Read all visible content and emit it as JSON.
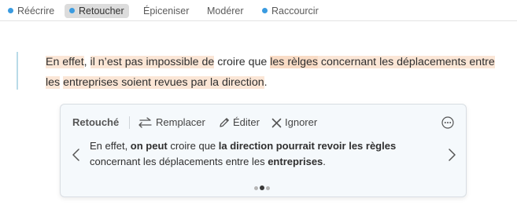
{
  "toolbar": {
    "items": [
      {
        "label": "Réécrire",
        "dot": true
      },
      {
        "label": "Retoucher",
        "dot": true,
        "active": true
      },
      {
        "label": "Épiceniser",
        "dot": false
      },
      {
        "label": "Modérer",
        "dot": false
      },
      {
        "label": "Raccourcir",
        "dot": true
      }
    ]
  },
  "document": {
    "segments": [
      {
        "text": "En effet",
        "hl": "a"
      },
      {
        "text": ", ",
        "hl": ""
      },
      {
        "text": "il n’est pas impossible de",
        "hl": "a"
      },
      {
        "text": " croire que ",
        "hl": ""
      },
      {
        "text": "les rèlges",
        "hl": "b"
      },
      {
        "text": " concernant les déplacements entre les",
        "hl": "a"
      },
      {
        "text": " ",
        "hl": ""
      },
      {
        "text": "entreprises soient revues par la direction",
        "hl": "a"
      },
      {
        "text": ".",
        "hl": ""
      }
    ]
  },
  "card": {
    "title": "Retouché",
    "replace_label": "Remplacer",
    "edit_label": "Éditer",
    "ignore_label": "Ignorer",
    "suggestion": {
      "parts": [
        {
          "text": "En effet, ",
          "bold": false
        },
        {
          "text": "on peut",
          "bold": true
        },
        {
          "text": " croire que ",
          "bold": false
        },
        {
          "text": "la direction pourrait revoir les règles",
          "bold": true
        },
        {
          "text": " concernant les déplacements entre les ",
          "bold": false
        },
        {
          "text": "entreprises",
          "bold": true
        },
        {
          "text": ".",
          "bold": false
        }
      ]
    },
    "pager": {
      "total": 3,
      "current": 2
    }
  },
  "colors": {
    "accent": "#3a9be0",
    "highlight_light": "#fbe6d6",
    "highlight_strong": "#f9dcc6",
    "card_bg": "#f5f9fc"
  }
}
